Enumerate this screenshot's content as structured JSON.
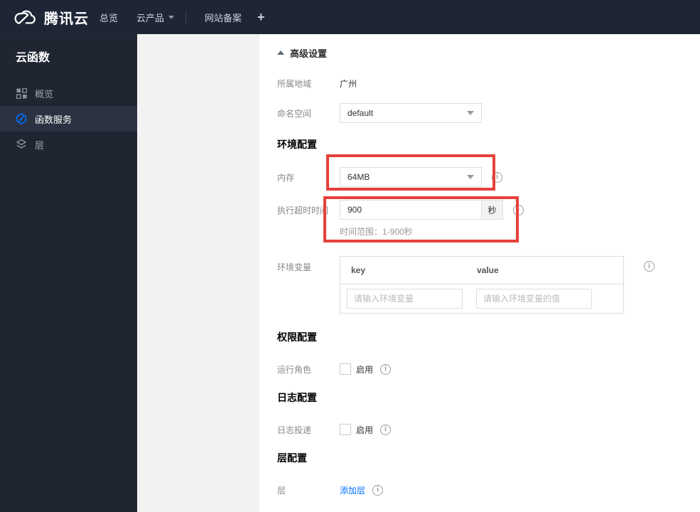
{
  "topbar": {
    "brand": "腾讯云",
    "items": [
      {
        "label": "总览"
      },
      {
        "label": "云产品",
        "has_dropdown": true
      },
      {
        "label": "网站备案"
      },
      {
        "label": "+"
      }
    ]
  },
  "sidebar": {
    "title": "云函数",
    "items": [
      {
        "label": "概览",
        "icon": "grid-icon",
        "active": false
      },
      {
        "label": "函数服务",
        "icon": "scf-hexagon-icon",
        "active": true
      },
      {
        "label": "层",
        "icon": "layers-icon",
        "active": false
      }
    ]
  },
  "form": {
    "advanced_settings_label": "高级设置",
    "region_label": "所属地域",
    "region_value": "广州",
    "namespace_label": "命名空间",
    "namespace_value": "default",
    "env_section_title": "环境配置",
    "memory_label": "内存",
    "memory_value": "64MB",
    "timeout_label": "执行超时时间",
    "timeout_value": "900",
    "timeout_unit": "秒",
    "timeout_hint": "时间范围：1-900秒",
    "env_vars_label": "环境变量",
    "env_vars_key_header": "key",
    "env_vars_value_header": "value",
    "env_vars_key_placeholder": "请输入环境变量",
    "env_vars_value_placeholder": "请输入环境变量的值",
    "perm_section_title": "权限配置",
    "run_role_label": "运行角色",
    "run_role_checkbox_label": "启用",
    "log_section_title": "日志配置",
    "log_delivery_label": "日志投递",
    "log_delivery_checkbox_label": "启用",
    "layer_section_title": "层配置",
    "layer_label": "层",
    "layer_add_link": "添加层",
    "info_glyph": "i"
  },
  "colors": {
    "topbar_bg": "#1e2636",
    "sidebar_bg": "#202631",
    "sidebar_active_bg": "#2b3342",
    "accent_blue": "#006eff",
    "annotation_red": "#e5413a",
    "page_gray": "#f2f2f2"
  }
}
